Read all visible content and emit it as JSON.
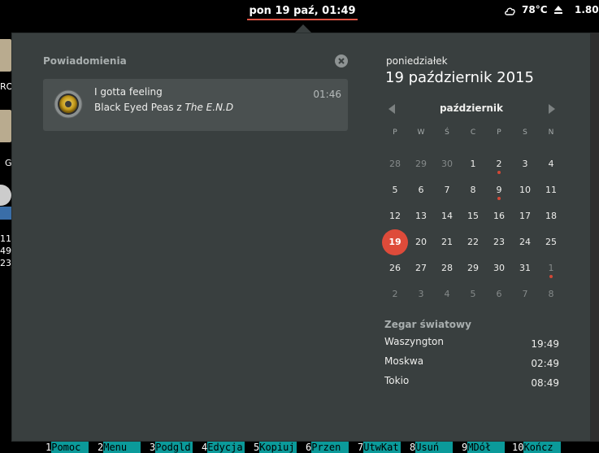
{
  "topbar": {
    "clock": "pon 19 paź, 01:49",
    "temperature": "78°C",
    "battery": "1.80"
  },
  "desktop": {
    "fragments": [
      "RO",
      "G",
      "11",
      "49",
      "23_"
    ]
  },
  "notifications": {
    "title": "Powiadomienia",
    "items": [
      {
        "icon": "speaker-icon",
        "title": "I gotta feeling",
        "artist": "Black Eyed Peas",
        "connector": "z",
        "album": "The E.N.D",
        "time": "01:46"
      }
    ]
  },
  "calendar": {
    "weekday": "poniedziałek",
    "full_date": "19 październik 2015",
    "month": "październik",
    "day_headers": [
      "P",
      "W",
      "Ś",
      "C",
      "P",
      "S",
      "N"
    ],
    "weeks": [
      [
        {
          "d": "28",
          "o": true
        },
        {
          "d": "29",
          "o": true
        },
        {
          "d": "30",
          "o": true
        },
        {
          "d": "1"
        },
        {
          "d": "2",
          "ev": true
        },
        {
          "d": "3"
        },
        {
          "d": "4"
        }
      ],
      [
        {
          "d": "5"
        },
        {
          "d": "6"
        },
        {
          "d": "7"
        },
        {
          "d": "8"
        },
        {
          "d": "9",
          "ev": true
        },
        {
          "d": "10"
        },
        {
          "d": "11"
        }
      ],
      [
        {
          "d": "12"
        },
        {
          "d": "13"
        },
        {
          "d": "14"
        },
        {
          "d": "15"
        },
        {
          "d": "16"
        },
        {
          "d": "17"
        },
        {
          "d": "18"
        }
      ],
      [
        {
          "d": "19",
          "today": true
        },
        {
          "d": "20"
        },
        {
          "d": "21"
        },
        {
          "d": "22"
        },
        {
          "d": "23"
        },
        {
          "d": "24"
        },
        {
          "d": "25"
        }
      ],
      [
        {
          "d": "26"
        },
        {
          "d": "27"
        },
        {
          "d": "28"
        },
        {
          "d": "29"
        },
        {
          "d": "30"
        },
        {
          "d": "31"
        },
        {
          "d": "1",
          "o": true,
          "ev": true
        }
      ],
      [
        {
          "d": "2",
          "o": true
        },
        {
          "d": "3",
          "o": true
        },
        {
          "d": "4",
          "o": true
        },
        {
          "d": "5",
          "o": true
        },
        {
          "d": "6",
          "o": true
        },
        {
          "d": "7",
          "o": true
        },
        {
          "d": "8",
          "o": true
        }
      ]
    ],
    "today_color": "#de4b3a",
    "event_dot_color": "#d34836"
  },
  "world_clocks": {
    "title": "Zegar światowy",
    "items": [
      {
        "city": "Waszyngton",
        "time": "19:49"
      },
      {
        "city": "Moskwa",
        "time": "02:49"
      },
      {
        "city": "Tokio",
        "time": "08:49"
      }
    ]
  },
  "mc_bar": [
    {
      "num": "1",
      "label": "Pomoc"
    },
    {
      "num": "2",
      "label": "Menu"
    },
    {
      "num": "3",
      "label": "Podgld"
    },
    {
      "num": "4",
      "label": "Edycja"
    },
    {
      "num": "5",
      "label": "Kopiuj"
    },
    {
      "num": "6",
      "label": "Przen"
    },
    {
      "num": "7",
      "label": "UtwKat"
    },
    {
      "num": "8",
      "label": "Usuń"
    },
    {
      "num": "9",
      "label": "MDół"
    },
    {
      "num": "10",
      "label": "Kończ"
    }
  ]
}
